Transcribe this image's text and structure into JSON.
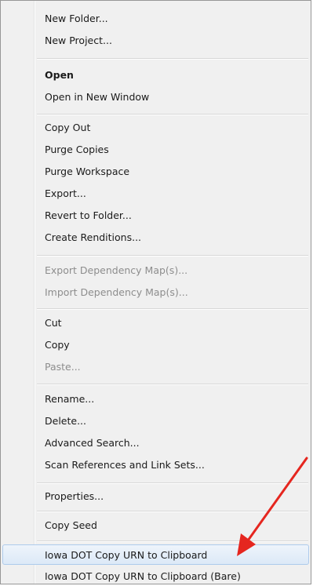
{
  "menu": {
    "items": [
      {
        "label": "New Folder...",
        "enabled": true
      },
      {
        "label": "New Project...",
        "enabled": true
      },
      {
        "label": "Open",
        "enabled": true,
        "bold": true
      },
      {
        "label": "Open in New Window",
        "enabled": true
      },
      {
        "label": "Copy Out",
        "enabled": true
      },
      {
        "label": "Purge Copies",
        "enabled": true
      },
      {
        "label": "Purge Workspace",
        "enabled": true
      },
      {
        "label": "Export...",
        "enabled": true
      },
      {
        "label": "Revert to Folder...",
        "enabled": true
      },
      {
        "label": "Create Renditions...",
        "enabled": true
      },
      {
        "label": "Export Dependency Map(s)...",
        "enabled": false
      },
      {
        "label": "Import Dependency Map(s)...",
        "enabled": false
      },
      {
        "label": "Cut",
        "enabled": true
      },
      {
        "label": "Copy",
        "enabled": true
      },
      {
        "label": "Paste...",
        "enabled": false
      },
      {
        "label": "Rename...",
        "enabled": true
      },
      {
        "label": "Delete...",
        "enabled": true
      },
      {
        "label": "Advanced Search...",
        "enabled": true
      },
      {
        "label": "Scan References and Link Sets...",
        "enabled": true
      },
      {
        "label": "Properties...",
        "enabled": true
      },
      {
        "label": "Copy Seed",
        "enabled": true
      },
      {
        "label": "Iowa DOT Copy URN to Clipboard",
        "enabled": true,
        "highlighted": true
      },
      {
        "label": "Iowa DOT Copy URN to Clipboard (Bare)",
        "enabled": true
      }
    ]
  },
  "colors": {
    "menu_background": "#f0f0f0",
    "disabled_text": "#8d8d8d",
    "highlight_border": "#aecbec",
    "arrow": "#e5261f"
  },
  "annotation": {
    "icon": "red-arrow-icon"
  }
}
